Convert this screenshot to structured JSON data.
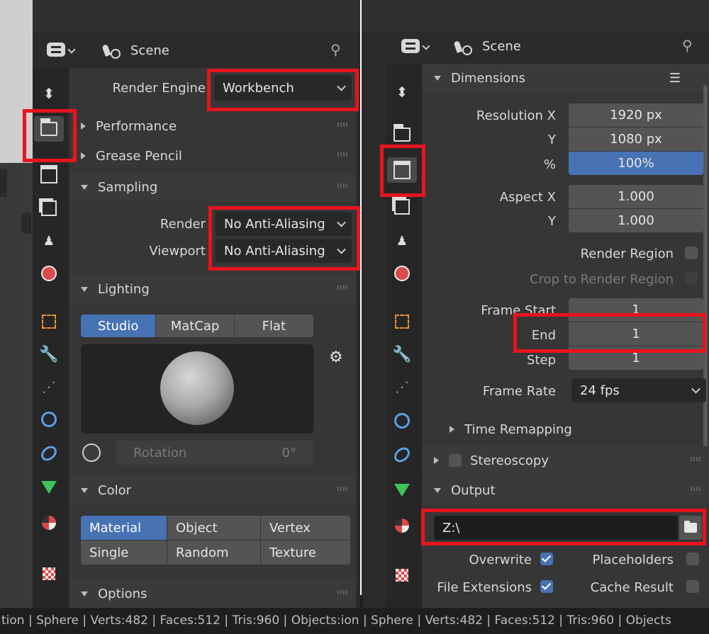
{
  "left": {
    "header": {
      "context": "Scene"
    },
    "render_engine": {
      "label": "Render Engine",
      "value": "Workbench"
    },
    "panels": {
      "performance": "Performance",
      "grease_pencil": "Grease Pencil",
      "sampling": "Sampling",
      "lighting": "Lighting",
      "color": "Color",
      "options": "Options"
    },
    "sampling": {
      "render_label": "Render",
      "render_value": "No Anti-Aliasing",
      "viewport_label": "Viewport",
      "viewport_value": "No Anti-Aliasing"
    },
    "lighting": {
      "modes": [
        "Studio",
        "MatCap",
        "Flat"
      ],
      "active": "Studio",
      "rotation_label": "Rotation",
      "rotation_value": "0°"
    },
    "color": {
      "options": [
        "Material",
        "Object",
        "Vertex",
        "Single",
        "Random",
        "Texture"
      ],
      "active": "Material"
    }
  },
  "right": {
    "header": {
      "context": "Scene"
    },
    "panels": {
      "dimensions": "Dimensions",
      "time_remapping": "Time Remapping",
      "stereoscopy": "Stereoscopy",
      "output": "Output"
    },
    "dimensions": {
      "resolution_x_label": "Resolution X",
      "resolution_x": "1920 px",
      "resolution_y_label": "Y",
      "resolution_y": "1080 px",
      "percent_label": "%",
      "percent": "100%",
      "aspect_x_label": "Aspect X",
      "aspect_x": "1.000",
      "aspect_y_label": "Y",
      "aspect_y": "1.000",
      "render_region_label": "Render Region",
      "crop_label": "Crop to Render Region",
      "frame_start_label": "Frame Start",
      "frame_start": "1",
      "end_label": "End",
      "end": "1",
      "step_label": "Step",
      "step": "1",
      "frame_rate_label": "Frame Rate",
      "frame_rate": "24 fps"
    },
    "output": {
      "path": "Z:\\",
      "overwrite_label": "Overwrite",
      "overwrite": true,
      "placeholders_label": "Placeholders",
      "placeholders": false,
      "file_extensions_label": "File Extensions",
      "file_extensions": true,
      "cache_result_label": "Cache Result",
      "cache_result": false
    }
  },
  "status_bar": {
    "text": "tion | Sphere | Verts:482 | Faces:512 | Tris:960 | Objects:ion | Sphere | Verts:482 | Faces:512 | Tris:960 | Objects"
  },
  "colors": {
    "highlight": "#e8141e",
    "accent": "#4772b3",
    "panel_bg": "#363636",
    "header_bg": "#3a3a3a"
  }
}
